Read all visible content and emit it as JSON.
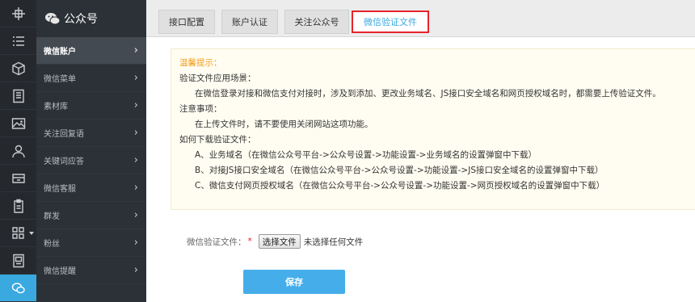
{
  "rail": {
    "items": [
      {
        "icon": "plus-cross-icon"
      },
      {
        "icon": "list-icon"
      },
      {
        "icon": "cube-icon"
      },
      {
        "icon": "document-icon"
      },
      {
        "icon": "image-icon"
      },
      {
        "icon": "user-icon"
      },
      {
        "icon": "store-icon"
      },
      {
        "icon": "clipboard-icon"
      },
      {
        "icon": "grid-icon"
      },
      {
        "icon": "note-icon"
      },
      {
        "icon": "wechat-icon"
      }
    ],
    "active_color": "#3aa9e0"
  },
  "menu": {
    "header": "公众号",
    "items": [
      {
        "label": "微信账户",
        "active": true
      },
      {
        "label": "微信菜单"
      },
      {
        "label": "素材库"
      },
      {
        "label": "关注回复语"
      },
      {
        "label": "关键词应答"
      },
      {
        "label": "微信客服"
      },
      {
        "label": "群发"
      },
      {
        "label": "粉丝"
      },
      {
        "label": "微信提醒"
      }
    ]
  },
  "tabs": [
    {
      "label": "接口配置"
    },
    {
      "label": "账户认证"
    },
    {
      "label": "关注公众号"
    },
    {
      "label": "微信验证文件",
      "active": true
    }
  ],
  "tips": {
    "title": "温馨提示：",
    "line1": "验证文件应用场景：",
    "line2": "在微信登录对接和微信支付对接时，涉及到添加、更改业务域名、JS接口安全域名和网页授权域名时，都需要上传验证文件。",
    "line3": "注意事项：",
    "line4": "在上传文件时，请不要使用关闭网站这项功能。",
    "line5": "如何下载验证文件：",
    "line6": "A、业务域名（在微信公众号平台->公众号设置->功能设置->业务域名的设置弹窗中下载）",
    "line7": "B、对接JS接口安全域名（在微信公众号平台->公众号设置->功能设置->JS接口安全域名的设置弹窗中下载）",
    "line8": "C、微信支付网页授权域名（在微信公众号平台->公众号设置->功能设置->网页授权域名的设置弹窗中下载）"
  },
  "form": {
    "label": "微信验证文件：",
    "required": "*",
    "choose_button": "选择文件",
    "file_status": "未选择任何文件"
  },
  "save_button": "保存",
  "colors": {
    "accent": "#45aeea",
    "tip_title": "#f29b1d",
    "active_tab_border": "#e8232d"
  }
}
